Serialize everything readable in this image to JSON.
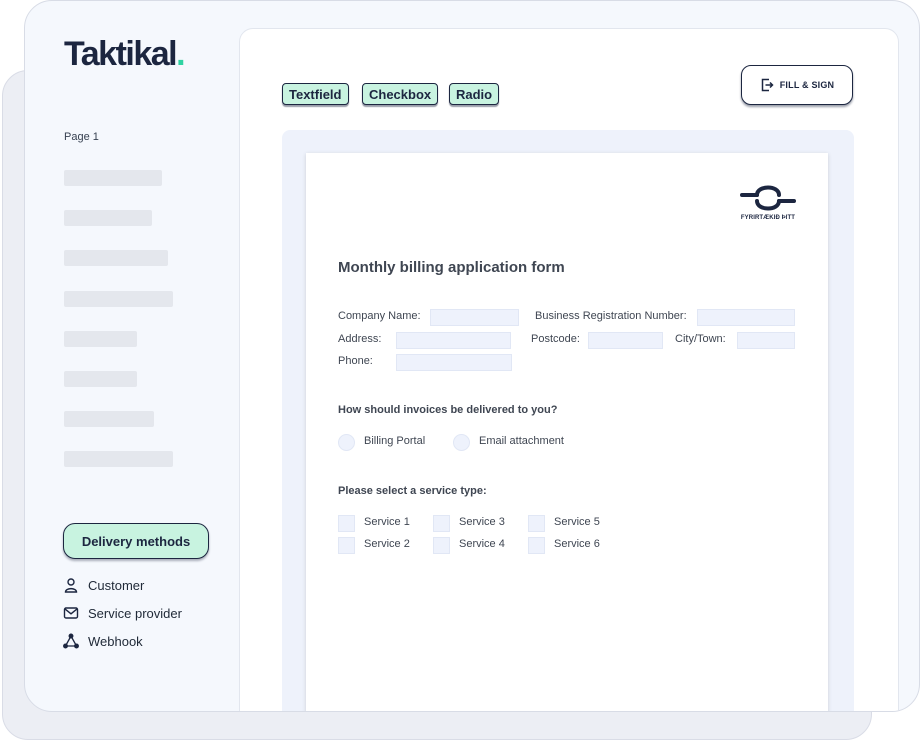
{
  "sidebar": {
    "logo_text": "Taktikal",
    "logo_dot": ".",
    "page_label": "Page 1",
    "delivery_button": "Delivery methods",
    "methods": [
      {
        "label": "Customer",
        "icon": "user-icon"
      },
      {
        "label": "Service provider",
        "icon": "mail-icon"
      },
      {
        "label": "Webhook",
        "icon": "webhook-icon"
      }
    ]
  },
  "toolbar": {
    "chips": [
      "Textfield",
      "Checkbox",
      "Radio"
    ],
    "fill_sign_label": "FILL & SIGN"
  },
  "document": {
    "company_logo_text": "FYRIRTÆKIÐ ÞITT",
    "title": "Monthly billing application form",
    "fields": {
      "company_name": "Company Name:",
      "business_reg": "Business Registration Number:",
      "address": "Address:",
      "postcode": "Postcode:",
      "city": "City/Town:",
      "phone": "Phone:"
    },
    "invoice_question": "How should invoices be delivered to you?",
    "invoice_options": [
      "Billing Portal",
      "Email attachment"
    ],
    "service_question": "Please select a service type:",
    "services": [
      "Service 1",
      "Service 2",
      "Service 3",
      "Service 4",
      "Service 5",
      "Service 6"
    ]
  },
  "colors": {
    "brand_navy": "#1c2640",
    "accent_mint": "#c8f3e0",
    "logo_dot": "#2fd3a2"
  }
}
